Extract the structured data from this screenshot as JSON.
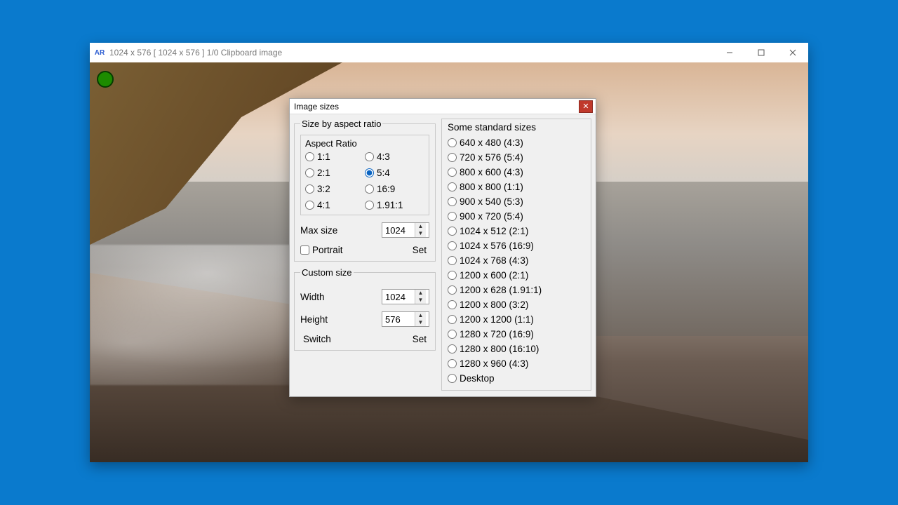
{
  "window": {
    "title": "1024 x 576 [ 1024 x 576 ] 1/0 Clipboard image",
    "app_icon_glyph": "AR"
  },
  "dialog": {
    "title": "Image sizes",
    "aspect": {
      "legend": "Size by aspect ratio",
      "group_label": "Aspect Ratio",
      "ratios_left": [
        "1:1",
        "2:1",
        "3:2",
        "4:1"
      ],
      "ratios_right": [
        "4:3",
        "5:4",
        "16:9",
        "1.91:1"
      ],
      "selected": "5:4",
      "maxsize_label": "Max size",
      "maxsize_value": "1024",
      "portrait_label": "Portrait",
      "set_label": "Set"
    },
    "custom": {
      "legend": "Custom size",
      "width_label": "Width",
      "width_value": "1024",
      "height_label": "Height",
      "height_value": "576",
      "switch_label": "Switch",
      "set_label": "Set"
    },
    "standard": {
      "legend": "Some standard sizes",
      "items": [
        "640 x 480 (4:3)",
        "720 x 576 (5:4)",
        "800 x 600 (4:3)",
        "800 x 800 (1:1)",
        "900 x 540 (5:3)",
        "900 x 720 (5:4)",
        "1024 x 512 (2:1)",
        "1024 x 576 (16:9)",
        "1024 x 768 (4:3)",
        "1200 x 600 (2:1)",
        "1200 x 628 (1.91:1)",
        "1200 x 800 (3:2)",
        "1200 x 1200 (1:1)",
        "1280 x 720 (16:9)",
        "1280 x 800 (16:10)",
        "1280 x 960 (4:3)",
        "Desktop"
      ]
    }
  }
}
